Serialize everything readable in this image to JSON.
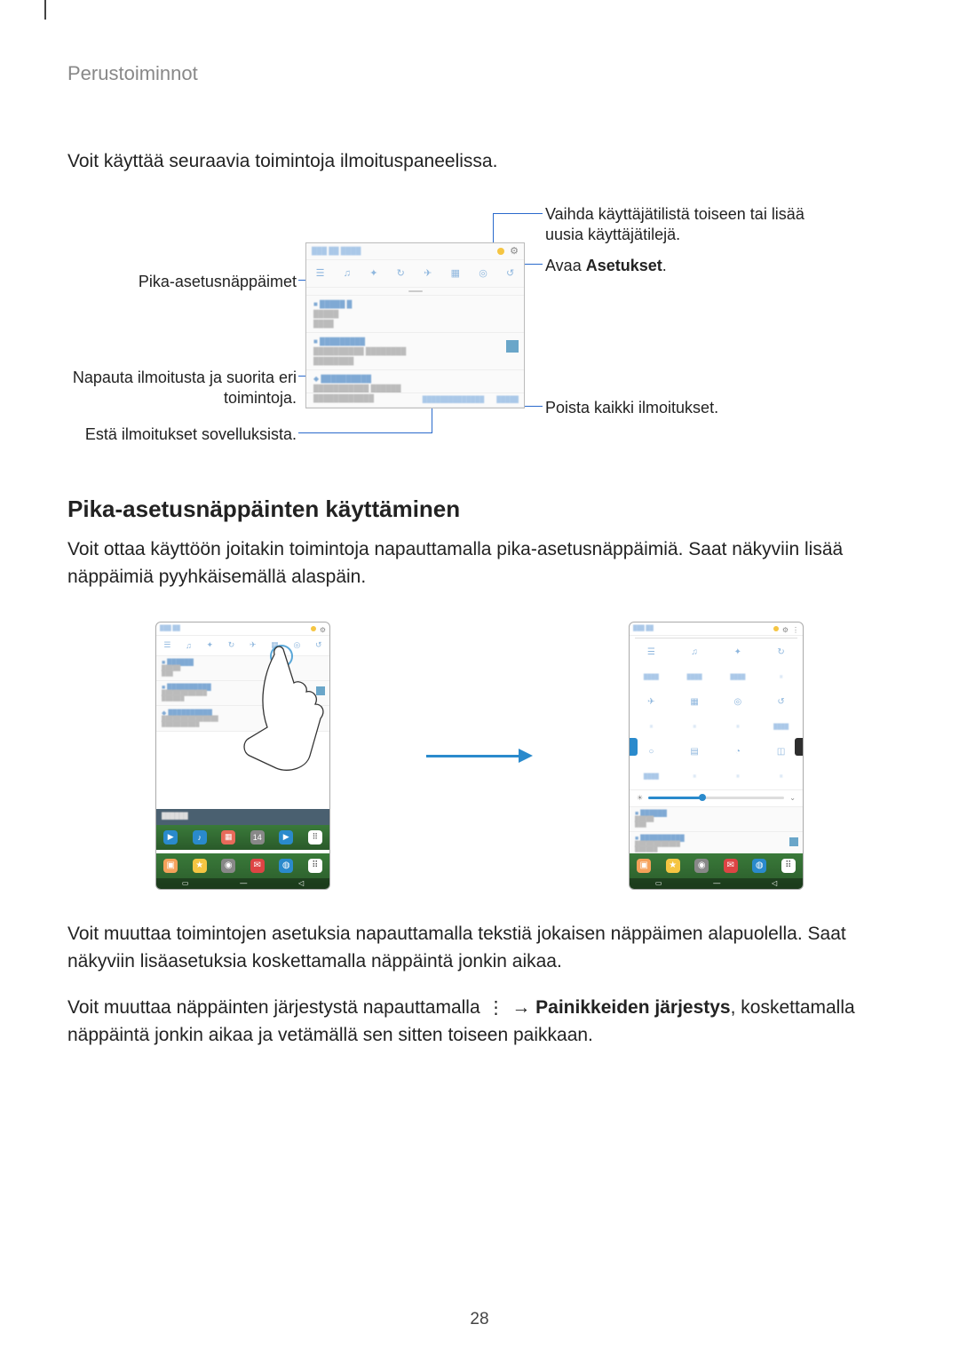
{
  "header": {
    "title": "Perustoiminnot"
  },
  "intro": "Voit käyttää seuraavia toimintoja ilmoituspaneelissa.",
  "diagram1": {
    "left": {
      "quick_settings": "Pika-asetusnäppäimet",
      "tap_notification": "Napauta ilmoitusta ja suorita eri toimintoja.",
      "block_notifications": "Estä ilmoitukset sovelluksista."
    },
    "right": {
      "switch_user": "Vaihda käyttäjätilistä toiseen tai lisää uusia käyttäjätilejä.",
      "open_settings_pre": "Avaa ",
      "open_settings_bold": "Asetukset",
      "open_settings_post": ".",
      "clear_all": "Poista kaikki ilmoitukset."
    }
  },
  "section2": {
    "heading": "Pika-asetusnäppäinten käyttäminen",
    "p1": "Voit ottaa käyttöön joitakin toimintoja napauttamalla pika-asetusnäppäimiä. Saat näkyviin lisää näppäimiä pyyhkäisemällä alaspäin."
  },
  "section3": {
    "p2": "Voit muuttaa toimintojen asetuksia napauttamalla tekstiä jokaisen näppäimen alapuolella. Saat näkyviin lisäasetuksia koskettamalla näppäintä jonkin aikaa.",
    "p3_pre": "Voit muuttaa näppäinten järjestystä napauttamalla ",
    "p3_arrow": " → ",
    "p3_bold": "Painikkeiden järjestys",
    "p3_post": ", koskettamalla näppäintä jonkin aikaa ja vetämällä sen sitten toiseen paikkaan."
  },
  "page_number": "28"
}
